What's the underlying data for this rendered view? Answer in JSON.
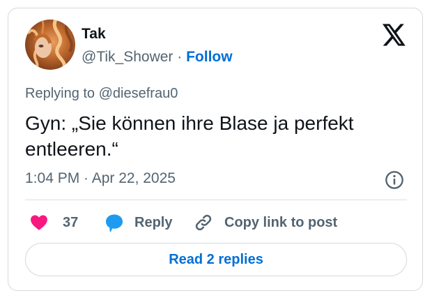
{
  "tweet": {
    "author_name": "Tak",
    "author_handle": "@Tik_Shower",
    "separator": "·",
    "follow_label": "Follow",
    "replying_to_label": "Replying to",
    "replying_to_handle": "@diesefrau0",
    "text": "Gyn: „Sie können ihre Blase ja perfekt entleeren.“",
    "timestamp": "1:04 PM · Apr 22, 2025",
    "likes": "37",
    "reply_label": "Reply",
    "copy_link_label": "Copy link to post",
    "read_replies_label": "Read 2 replies"
  },
  "icons": {
    "brand": "x-logo-icon",
    "info": "info-icon",
    "like": "heart-icon",
    "reply": "speech-bubble-icon",
    "copy": "link-icon"
  },
  "colors": {
    "like": "#f91880",
    "reply": "#1d9bf0",
    "link": "#006fd6",
    "muted": "#536471",
    "text": "#0f1419"
  }
}
